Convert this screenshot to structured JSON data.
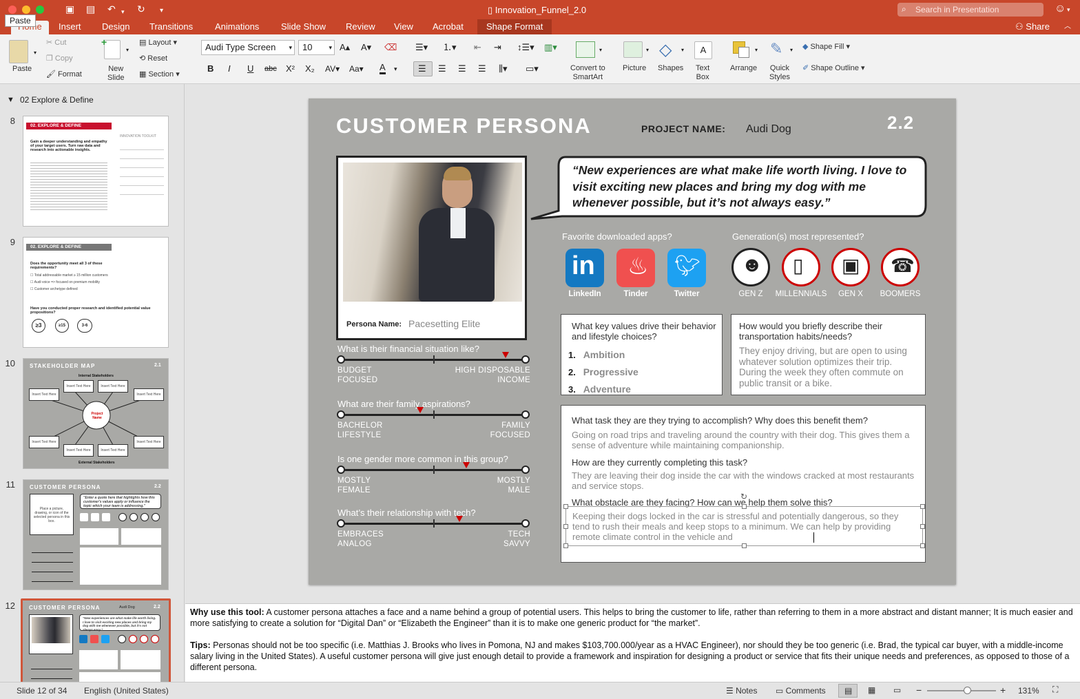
{
  "window": {
    "title": "Innovation_Funnel_2.0",
    "search_placeholder": "Search in Presentation"
  },
  "tabs": [
    "Home",
    "Insert",
    "Design",
    "Transitions",
    "Animations",
    "Slide Show",
    "Review",
    "View",
    "Acrobat",
    "Shape Format"
  ],
  "tooltip": "Paste",
  "share_label": "Share",
  "ribbon": {
    "paste": "Paste",
    "cut": "Cut",
    "copy": "Copy",
    "format": "Format",
    "new_slide": [
      "New",
      "Slide"
    ],
    "layout": "Layout",
    "reset": "Reset",
    "section": "Section",
    "font": "Audi Type Screen",
    "size": "10",
    "convert": [
      "Convert to",
      "SmartArt"
    ],
    "picture": "Picture",
    "shapes": "Shapes",
    "textbox": [
      "Text",
      "Box"
    ],
    "arrange": "Arrange",
    "quick_styles": [
      "Quick",
      "Styles"
    ],
    "shape_fill": "Shape Fill",
    "shape_outline": "Shape Outline"
  },
  "left_panel": {
    "section_header": "02 Explore & Define",
    "slide_numbers": [
      "8",
      "9",
      "10",
      "11",
      "12"
    ],
    "t8": {
      "header": "02. EXPLORE & DEFINE",
      "heading": "Gain a deeper understanding and empathy of your target users. Turn raw data and research into actionable insights.",
      "toolkit": "INNOVATION TOOLKIT"
    },
    "t9": {
      "header": "02. EXPLORE & DEFINE",
      "question": "Does the opportunity meet all 3 of these requirements?",
      "c1": "Total addressable market ≥ 15 million customers",
      "c2": "Audi voice => focused on premium mobility",
      "c3": "Customer archetype defined",
      "q2": "Have you conducted proper research and identified potential value propositions?",
      "b1": "≥3",
      "b2": "≥15",
      "b3": "3-6"
    },
    "t10": {
      "title": "STAKEHOLDER MAP",
      "num": "2.1",
      "internal": "Internal Stakeholders",
      "external": "External Stakeholders",
      "center": "Project Name",
      "node": "Insert Text Here"
    },
    "t11": {
      "title": "CUSTOMER PERSONA",
      "num": "2.2",
      "quote": "\"Enter a quote here that highlights how this customer's values apply or influence the topic which your team is addressing.\"",
      "photo": "Place a picture, drawing, or icon of the selected persona in this box."
    },
    "t12": {
      "title": "CUSTOMER PERSONA",
      "num": "2.2",
      "project": "Audi Dog",
      "quote": "\"New experiences are what make life worth living. I love to visit exciting new places and bring my dog with me whenever possible, but it's not always easy.\""
    }
  },
  "slide": {
    "title": "CUSTOMER PERSONA",
    "project_label": "PROJECT NAME:",
    "project_name": "Audi Dog",
    "number": "2.2",
    "quote": "“New experiences are what make life worth living. I love to visit exciting new places and bring my dog with me whenever possible, but it’s not always easy.”",
    "persona_label": "Persona Name:",
    "persona_name": "Pacesetting Elite",
    "apps_question": "Favorite downloaded apps?",
    "apps": [
      {
        "name": "LinkedIn",
        "color": "#1479c2",
        "icon": "linkedin-icon"
      },
      {
        "name": "Tinder",
        "color": "#f0504f",
        "icon": "flame-icon"
      },
      {
        "name": "Twitter",
        "color": "#1da1f2",
        "icon": "bird-icon"
      }
    ],
    "gen_question": "Generation(s) most represented?",
    "generations": [
      {
        "name": "GEN Z",
        "icon": "robot-icon",
        "selected": true
      },
      {
        "name": "MILLENNIALS",
        "icon": "phone-icon",
        "selected": false
      },
      {
        "name": "GEN X",
        "icon": "floppy-disk-icon",
        "selected": false
      },
      {
        "name": "BOOMERS",
        "icon": "rotary-phone-icon",
        "selected": false
      }
    ],
    "sliders": [
      {
        "question": "What is their financial situation like?",
        "left": [
          "BUDGET",
          "FOCUSED"
        ],
        "right": [
          "HIGH DISPOSABLE",
          "INCOME"
        ],
        "value": 0.89
      },
      {
        "question": "What are their family aspirations?",
        "left": [
          "BACHELOR",
          "LIFESTYLE"
        ],
        "right": [
          "FAMILY",
          "FOCUSED"
        ],
        "value": 0.43
      },
      {
        "question": "Is one gender more common in this group?",
        "left": [
          "MOSTLY",
          "FEMALE"
        ],
        "right": [
          "MOSTLY",
          "MALE"
        ],
        "value": 0.68
      },
      {
        "question": "What’s their relationship with tech?",
        "left": [
          "EMBRACES",
          "ANALOG"
        ],
        "right": [
          "TECH",
          "SAVVY"
        ],
        "value": 0.64
      }
    ],
    "values_question": "What key values drive their behavior and lifestyle choices?",
    "values": [
      "Ambition",
      "Progressive",
      "Adventure"
    ],
    "transport_question": "How would you briefly describe their transportation habits/needs?",
    "transport_answer": "They enjoy driving, but are open to using whatever solution optimizes their trip. During the week they often commute on public transit or a bike.",
    "task_q1": "What task they are they trying to accomplish? Why does this benefit them?",
    "task_a1": "Going on road trips and traveling around the country with their dog. This gives them a sense of adventure while maintaining companionship.",
    "task_q2": "How are they currently completing this task?",
    "task_a2": "They are leaving their dog inside the car with the windows cracked at most restaurants and service stops.",
    "task_q3": "What obstacle are they facing? How can we help them solve this?",
    "task_a3": "Keeping their dogs locked in the car is stressful and potentially dangerous, so they tend to rush their meals and keep stops to a minimum. We can help by providing remote climate control in the vehicle and"
  },
  "notes": {
    "why_label": "Why use this tool:",
    "why_text": " A customer persona attaches a face and a name behind a group of potential users. This helps to bring the customer to life, rather than referring to them in a more abstract and distant manner; It is much easier and more satisfying to create a solution for “Digital Dan” or “Elizabeth the Engineer” than it is to make one generic product for “the market”.",
    "tips_label": "Tips:",
    "tips_text": " Personas should not be too specific (i.e. Matthias J. Brooks who lives in Pomona, NJ and makes $103,700.000/year as a HVAC Engineer), nor should they be too generic (i.e. Brad, the typical car buyer, with a middle-income salary living in the United States). A useful customer persona will give just enough detail to provide a framework and inspiration for designing a product or service that fits their unique needs and preferences, as opposed to those of a different persona."
  },
  "status": {
    "slide": "Slide 12 of 34",
    "language": "English (United States)",
    "notes": "Notes",
    "comments": "Comments",
    "zoom": "131%"
  }
}
